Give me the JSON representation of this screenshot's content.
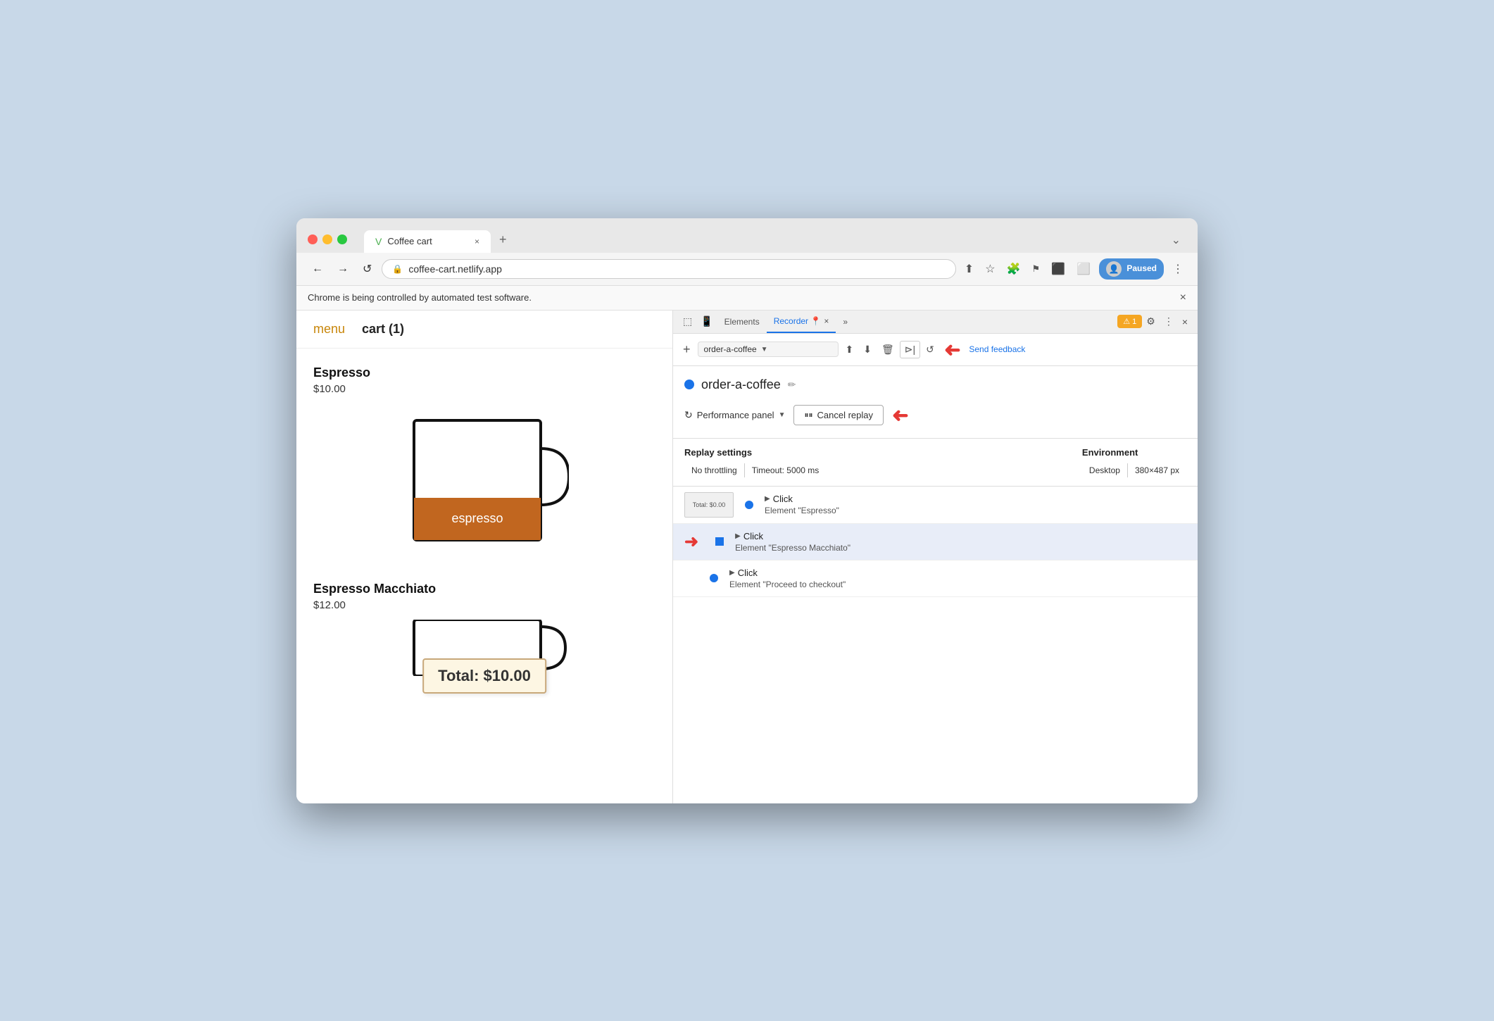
{
  "browser": {
    "traffic_lights": [
      "close",
      "minimize",
      "maximize"
    ],
    "tab": {
      "title": "Coffee cart",
      "favicon": "V",
      "close": "×"
    },
    "tab_new": "+",
    "tab_overflow": "⌄",
    "toolbar": {
      "back": "←",
      "forward": "→",
      "reload": "↺",
      "address": "coffee-cart.netlify.app",
      "lock_icon": "🔒",
      "share": "⬆",
      "star": "☆",
      "extensions": "🧩",
      "devtools_ext": "",
      "cast": "",
      "window": "⬜",
      "menu": "⋮",
      "profile_img": "👤",
      "paused_label": "Paused"
    },
    "notification": {
      "text": "Chrome is being controlled by automated test software.",
      "close": "×"
    }
  },
  "webpage": {
    "nav": {
      "menu_label": "menu",
      "cart_label": "cart (1)"
    },
    "products": [
      {
        "name": "Espresso",
        "price": "$10.00",
        "label": "espresso",
        "has_cup": true
      },
      {
        "name": "Espresso Macchiato",
        "price": "$12.00",
        "has_cup": true
      }
    ],
    "total_tooltip": "Total: $10.00"
  },
  "devtools": {
    "tabs": [
      {
        "label": "≡",
        "icon": true
      },
      {
        "label": "⬜",
        "icon": true
      },
      {
        "label": "Elements"
      },
      {
        "label": "Recorder 📍",
        "active": true,
        "close": "×"
      },
      {
        "label": "»"
      }
    ],
    "badge_count": "1",
    "gear_icon": "⚙",
    "more_icon": "⋮",
    "close_icon": "×",
    "toolbar": {
      "add_icon": "+",
      "recording_name": "order-a-coffee",
      "dropdown_icon": "▼",
      "upload_icon": "⬆",
      "download_icon": "⬇",
      "delete_icon": "🗑",
      "play_icon": "⊳",
      "loop_icon": "↺",
      "send_feedback": "Send feedback"
    },
    "recording": {
      "dot_color": "#1a73e8",
      "title": "order-a-coffee",
      "edit_icon": "✏",
      "perf_panel_label": "Performance panel",
      "perf_dropdown": "▼",
      "cancel_replay_label": "Cancel replay",
      "cancel_icon": "⏸"
    },
    "replay_settings": {
      "section_label": "Replay settings",
      "throttling_label": "No throttling",
      "timeout_label": "Timeout: 5000 ms",
      "env_label": "Environment",
      "env_value": "Desktop",
      "env_size": "380×487 px"
    },
    "steps": [
      {
        "type": "Click",
        "element": "Element \"Espresso\"",
        "has_thumbnail": true,
        "thumbnail_text": "Total: $0.00",
        "node_type": "circle",
        "active": false
      },
      {
        "type": "Click",
        "element": "Element \"Espresso Macchiato\"",
        "node_type": "square",
        "active": true,
        "has_red_arrow": true
      },
      {
        "type": "Click",
        "element": "Element \"Proceed to checkout\"",
        "node_type": "circle",
        "active": false
      }
    ]
  },
  "arrows": {
    "toolbar_arrow": "→",
    "cancel_arrow": "→",
    "step_arrow": "→",
    "color": "#e53935"
  }
}
